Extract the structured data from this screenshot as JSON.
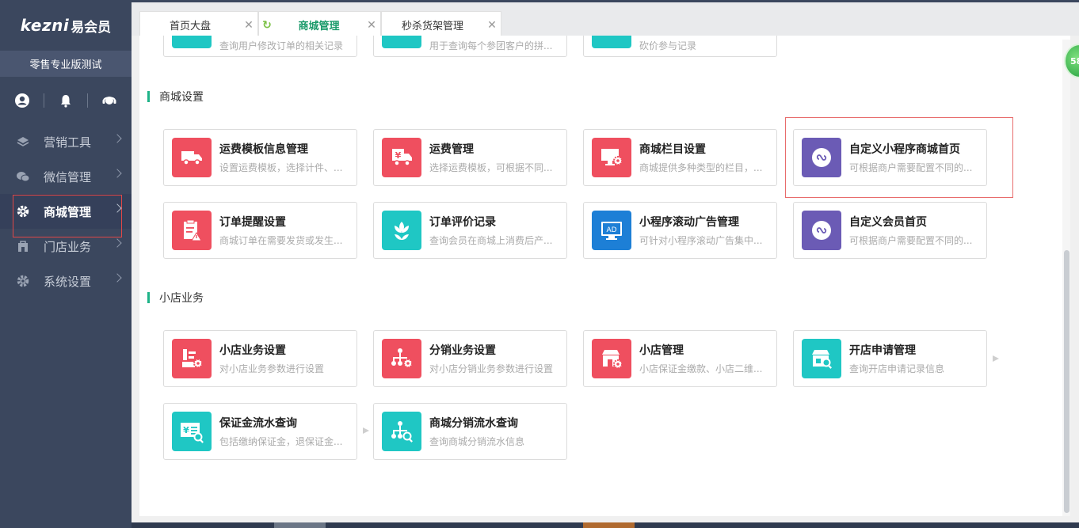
{
  "sidebar": {
    "brand": "kezni",
    "brand_sub": "易会员",
    "store_name": "零售专业版测试",
    "top_icons": [
      "user-icon",
      "bell-icon",
      "headset-icon"
    ],
    "menu": [
      {
        "label": "营销工具",
        "icon": "layers-icon"
      },
      {
        "label": "微信管理",
        "icon": "wechat-icon"
      },
      {
        "label": "商城管理",
        "icon": "gear-icon",
        "active": true
      },
      {
        "label": "门店业务",
        "icon": "store-icon"
      },
      {
        "label": "系统设置",
        "icon": "gear-icon"
      }
    ]
  },
  "tabs": [
    {
      "label": "首页大盘",
      "close": "✕"
    },
    {
      "label": "商城管理",
      "close": "✕",
      "active": true
    },
    {
      "label": "秒杀货架管理",
      "close": "✕"
    }
  ],
  "top_partial_cards": [
    {
      "desc": "查询用户修改订单的相关记录"
    },
    {
      "desc": "用于查询每个参团客户的拼..."
    },
    {
      "desc": "砍价参与记录"
    }
  ],
  "sections": [
    {
      "title": "商城设置",
      "cards": [
        {
          "title": "运费模板信息管理",
          "desc": "设置运费模板，选择计件、...",
          "color": "#ef4f5f",
          "icon": "truck-icon"
        },
        {
          "title": "运费管理",
          "desc": "选择运费模板，可根据不同...",
          "color": "#ef4f5f",
          "icon": "yuan-truck-icon"
        },
        {
          "title": "商城栏目设置",
          "desc": "商城提供多种类型的栏目，...",
          "color": "#ef4f5f",
          "icon": "monitor-gear-icon"
        },
        {
          "title": "自定义小程序商城首页",
          "desc": "可根据商户需要配置不同的...",
          "color": "#6b5bb5",
          "icon": "miniprogram-icon"
        },
        {
          "title": "订单提醒设置",
          "desc": "商城订单在需要发货或发生...",
          "color": "#ef4f5f",
          "icon": "clipboard-alert-icon"
        },
        {
          "title": "订单评价记录",
          "desc": "查询会员在商城上消费后产...",
          "color": "#1fc7c4",
          "icon": "flower-icon"
        },
        {
          "title": "小程序滚动广告管理",
          "desc": "可针对小程序滚动广告集中...",
          "color": "#1d7fd6",
          "icon": "ad-monitor-icon",
          "ad_text": "AD"
        },
        {
          "title": "自定义会员首页",
          "desc": "可根据商户需要配置不同的...",
          "color": "#6b5bb5",
          "icon": "miniprogram-icon"
        }
      ]
    },
    {
      "title": "小店业务",
      "cards": [
        {
          "title": "小店业务设置",
          "desc": "对小店业务参数进行设置",
          "color": "#ef4f5f",
          "icon": "list-gear-icon"
        },
        {
          "title": "分销业务设置",
          "desc": "对小店分销业务参数进行设置",
          "color": "#ef4f5f",
          "icon": "network-gear-icon"
        },
        {
          "title": "小店管理",
          "desc": "小店保证金缴款、小店二维...",
          "color": "#ef4f5f",
          "icon": "shop-gear-icon"
        },
        {
          "title": "开店申请管理",
          "desc": "查询开店申请记录信息",
          "color": "#1fc7c4",
          "icon": "shop-search-icon"
        },
        {
          "title": "保证金流水查询",
          "desc": "包括缴纳保证金，退保证金...",
          "color": "#1fc7c4",
          "icon": "yuan-list-search-icon"
        },
        {
          "title": "商城分销流水查询",
          "desc": "查询商城分销流水信息",
          "color": "#1fc7c4",
          "icon": "network-search-icon"
        }
      ]
    }
  ],
  "floating_badge": "58"
}
